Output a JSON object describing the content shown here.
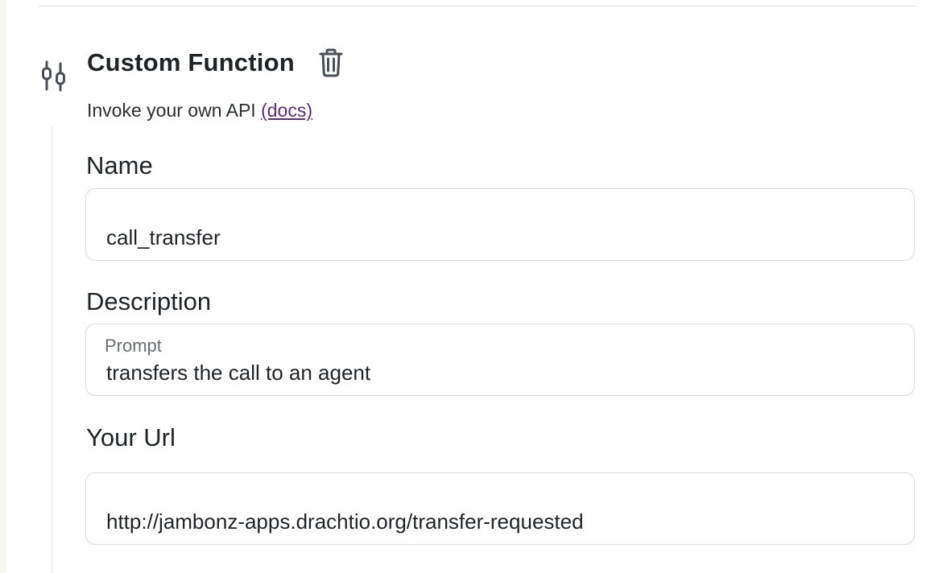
{
  "function": {
    "title": "Custom Function",
    "subtitle": "Invoke your own API",
    "docs_link": "(docs)",
    "icons": {
      "tool": "sliders-icon",
      "delete": "trash-icon"
    }
  },
  "fields": {
    "name": {
      "label": "Name",
      "value": "call_transfer"
    },
    "description": {
      "label": "Description",
      "hint": "Prompt",
      "value": "transfers the call to an agent"
    },
    "url": {
      "label": "Your Url",
      "value": "http://jambonz-apps.drachtio.org/transfer-requested"
    }
  },
  "colors": {
    "text": "#1f2328",
    "link": "#5b2a86",
    "border": "#dcdcdc",
    "icon": "#4a4f57"
  }
}
